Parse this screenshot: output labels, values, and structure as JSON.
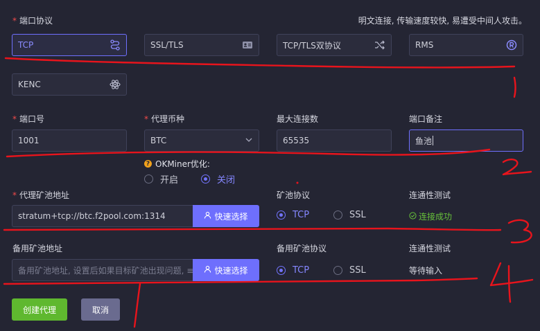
{
  "port_protocol": {
    "label": "端口协议",
    "hint": "明文连接, 传输速度较快, 易遭受中间人攻击。",
    "options": [
      "TCP",
      "SSL/TLS",
      "TCP/TLS双协议",
      "RMS",
      "KENC"
    ],
    "selected": "TCP"
  },
  "port": {
    "label": "端口号",
    "value": "1001"
  },
  "coin": {
    "label": "代理币种",
    "value": "BTC"
  },
  "max_conn": {
    "label": "最大连接数",
    "value": "65535"
  },
  "remark": {
    "label": "端口备注",
    "value": "鱼池"
  },
  "okminer": {
    "label": "OKMiner优化:",
    "on": "开启",
    "off": "关闭",
    "selected": "关闭"
  },
  "pool": {
    "label": "代理矿池地址",
    "value": "stratum+tcp://btc.f2pool.com:1314",
    "quick": "快速选择",
    "protocol_label": "矿池协议",
    "tcp": "TCP",
    "ssl": "SSL",
    "test_label": "连通性测试",
    "test_status": "连接成功"
  },
  "backup": {
    "label": "备用矿池地址",
    "placeholder": "备用矿池地址, 设置后如果目标矿池出现问题, ≡",
    "quick": "快速选择",
    "protocol_label": "备用矿池协议",
    "tcp": "TCP",
    "ssl": "SSL",
    "test_label": "连通性测试",
    "test_status": "等待输入"
  },
  "actions": {
    "create": "创建代理",
    "cancel": "取消"
  },
  "annotations": [
    "1",
    "2",
    "3",
    "4"
  ],
  "colors": {
    "accent": "#6e6ffd",
    "success": "#5fb82f",
    "required": "#f24b4b",
    "ink": "#e8141c"
  }
}
